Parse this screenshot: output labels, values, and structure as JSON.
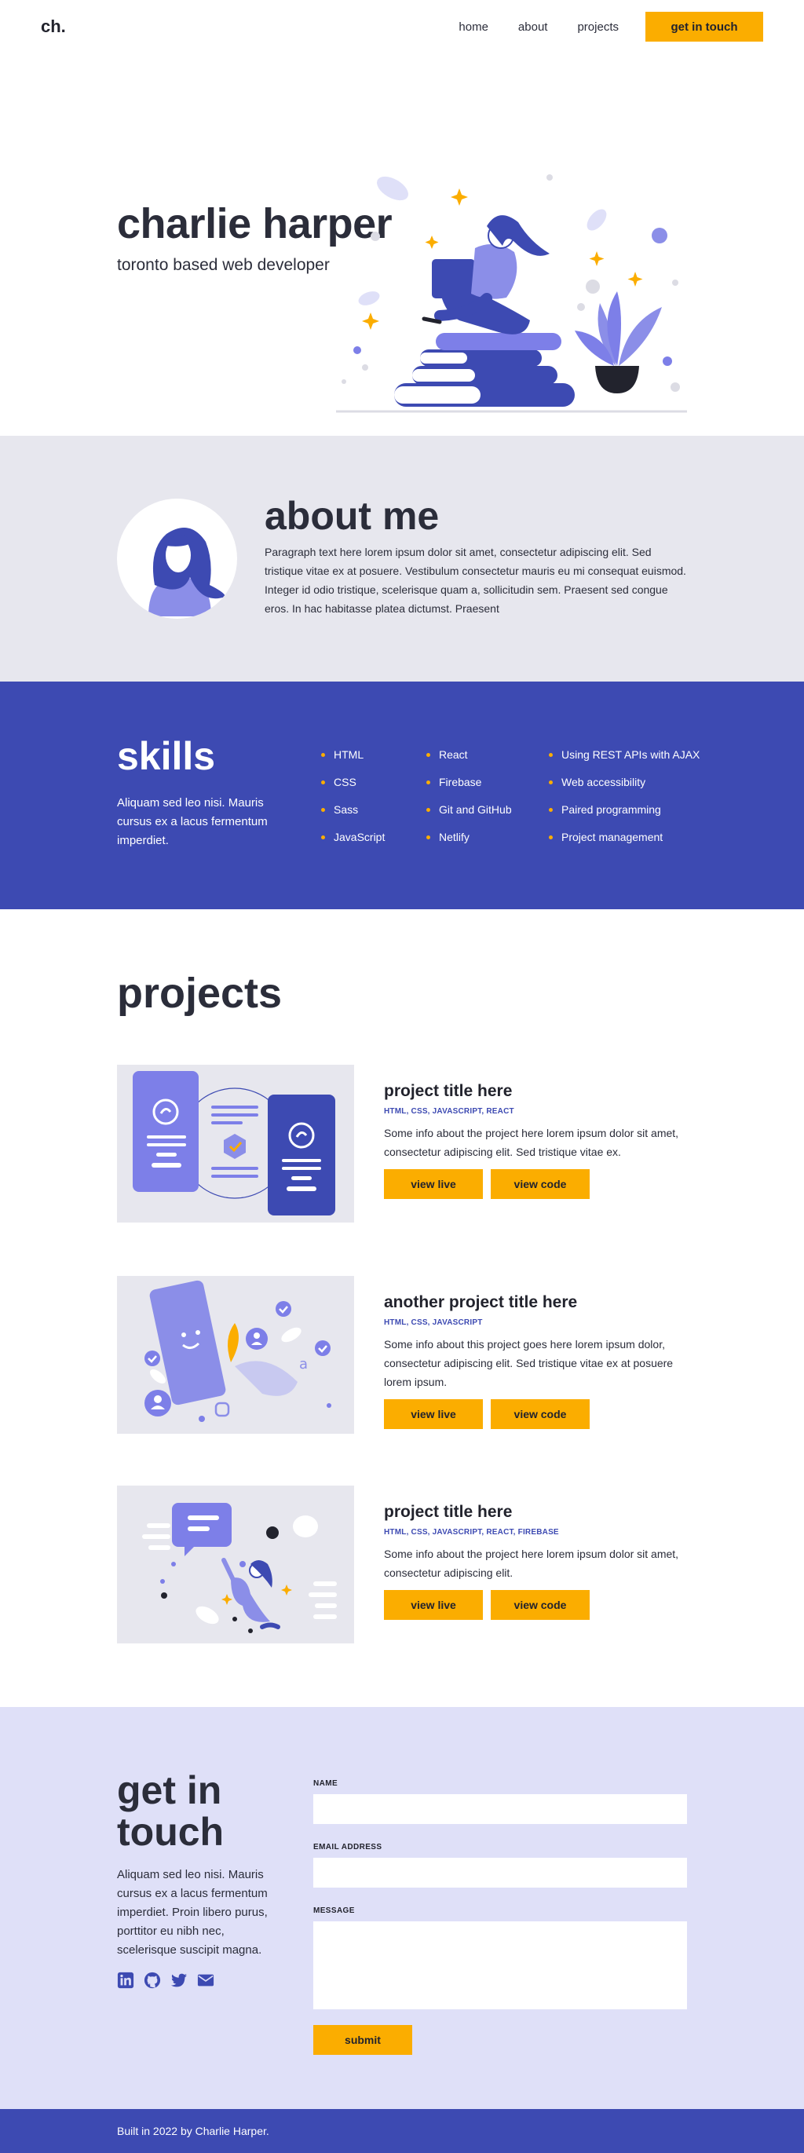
{
  "nav": {
    "logo": "ch.",
    "links": [
      "home",
      "about",
      "projects"
    ],
    "cta": "get in touch"
  },
  "hero": {
    "title": "charlie harper",
    "subtitle": "toronto based web developer"
  },
  "about": {
    "title": "about me",
    "text": "Paragraph text here lorem ipsum dolor sit amet, consectetur adipiscing elit. Sed tristique vitae ex at posuere. Vestibulum consectetur mauris eu mi consequat euismod. Integer id odio tristique, scelerisque quam a, sollicitudin sem. Praesent sed congue eros. In hac habitasse platea dictumst. Praesent"
  },
  "skills": {
    "title": "skills",
    "description": "Aliquam sed leo nisi. Mauris cursus ex a lacus fermentum imperdiet.",
    "col1": [
      "HTML",
      "CSS",
      "Sass",
      "JavaScript"
    ],
    "col2": [
      "React",
      "Firebase",
      "Git and GitHub",
      "Netlify"
    ],
    "col3": [
      "Using REST APIs with AJAX",
      "Web accessibility",
      "Paired programming",
      "Project management"
    ]
  },
  "projects": {
    "title": "projects",
    "items": [
      {
        "title": "project title here",
        "tags": "HTML, CSS, JAVASCRIPT, REACT",
        "desc": "Some info about the project here lorem ipsum dolor sit amet, consectetur adipiscing elit. Sed tristique vitae ex.",
        "live": "view live",
        "code": "view code"
      },
      {
        "title": "another project title here",
        "tags": "HTML, CSS, JAVASCRIPT",
        "desc": "Some info about this project goes here lorem ipsum dolor, consectetur adipiscing elit. Sed tristique vitae ex at posuere lorem ipsum.",
        "live": "view live",
        "code": "view code"
      },
      {
        "title": "project title here",
        "tags": "HTML, CSS, JAVASCRIPT, REACT, FIREBASE",
        "desc": "Some info about the project here lorem ipsum dolor sit amet, consectetur adipiscing elit.",
        "live": "view live",
        "code": "view code"
      }
    ]
  },
  "contact": {
    "title": "get in touch",
    "description": "Aliquam sed leo nisi. Mauris cursus ex a lacus fermentum imperdiet. Proin libero purus, porttitor eu nibh nec, scelerisque suscipit magna.",
    "name_label": "NAME",
    "email_label": "EMAIL ADDRESS",
    "message_label": "MESSAGE",
    "submit": "submit",
    "socials": [
      "linkedin-icon",
      "github-icon",
      "twitter-icon",
      "mail-icon"
    ]
  },
  "footer": {
    "text": "Built in 2022 by Charlie Harper."
  },
  "colors": {
    "primary": "#3d4ab2",
    "accent": "#fbad00",
    "light_gray": "#e7e7ee",
    "lavender": "#dfe0f8",
    "illustration_purple": "#7d7fe8",
    "text": "#2b2d3a"
  }
}
